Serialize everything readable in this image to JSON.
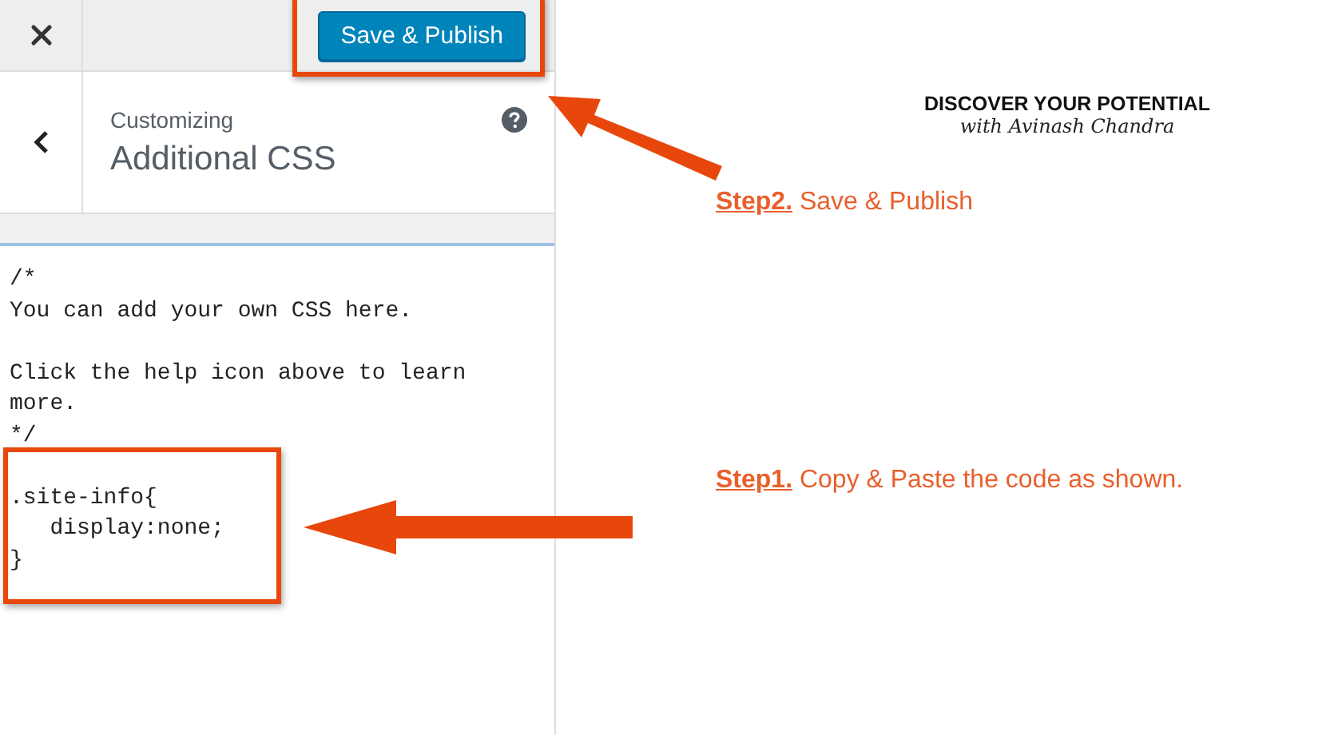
{
  "top_bar": {
    "publish_button": "Save & Publish"
  },
  "section": {
    "breadcrumb": "Customizing",
    "title": "Additional CSS"
  },
  "css_editor": {
    "code": "/*\nYou can add your own CSS here.\n\nClick the help icon above to learn\nmore.\n*/\n\n.site-info{\n   display:none;\n}"
  },
  "branding": {
    "headline": "DISCOVER YOUR POTENTIAL",
    "byline": "with Avinash Chandra"
  },
  "annotations": [
    {
      "text": "**Step2.** Save & Publish"
    },
    {
      "text": "**Step1.** Copy & Paste the code as shown."
    }
  ]
}
